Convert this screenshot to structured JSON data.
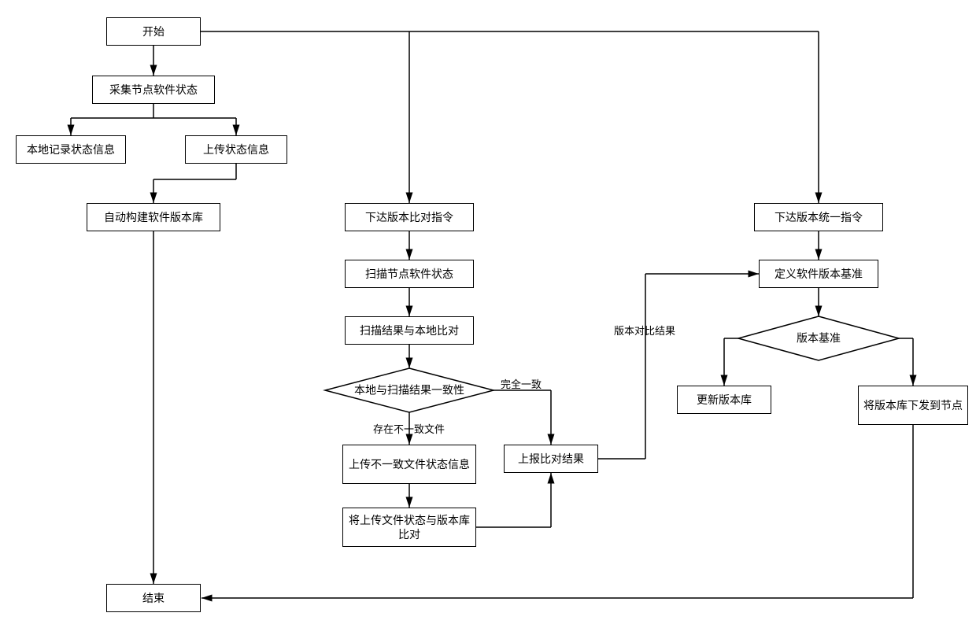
{
  "nodes": {
    "start": "开始",
    "collectStatus": "采集节点软件状态",
    "localRecord": "本地记录状态信息",
    "uploadStatus": "上传状态信息",
    "autoBuildRepo": "自动构建软件版本库",
    "issueCompareCmd": "下达版本比对指令",
    "scanNodeStatus": "扫描节点软件状态",
    "scanCompareLocal": "扫描结果与本地比对",
    "consistencyCheck": "本地与扫描结果一致性",
    "uploadInconsistent": "上传不一致文件状态信息",
    "compareWithRepo": "将上传文件状态与版本库比对",
    "reportCompare": "上报比对结果",
    "issueUnifyCmd": "下达版本统一指令",
    "defineBaseline": "定义软件版本基准",
    "versionBaseline": "版本基准",
    "updateRepo": "更新版本库",
    "deployToNode": "将版本库下发到节点",
    "end": "结束"
  },
  "edgeLabels": {
    "fullMatch": "完全一致",
    "hasInconsistent": "存在不一致文件",
    "versionCompareResult": "版本对比结果"
  }
}
